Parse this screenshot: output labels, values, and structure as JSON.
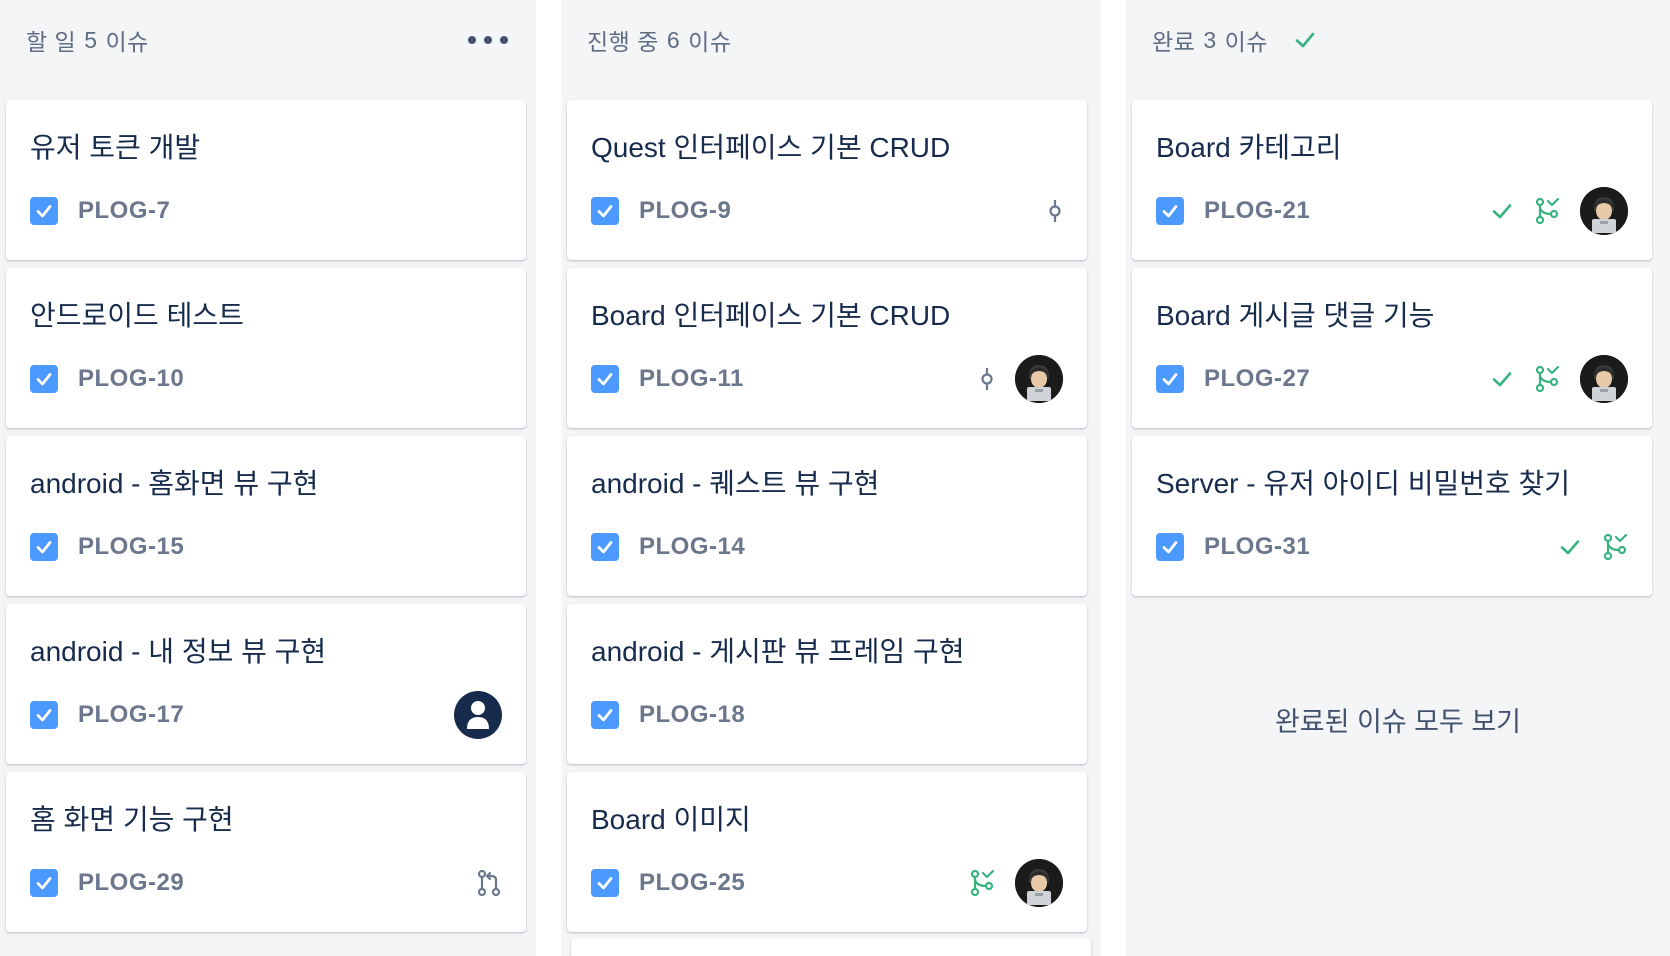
{
  "columns": [
    {
      "name": "할 일",
      "count": "5",
      "issues_label": "이슈",
      "cards": [
        {
          "title": "유저 토큰 개발",
          "key": "PLOG-7"
        },
        {
          "title": "안드로이드 테스트",
          "key": "PLOG-10"
        },
        {
          "title": "android - 홈화면 뷰 구현",
          "key": "PLOG-15"
        },
        {
          "title": "android - 내 정보 뷰 구현",
          "key": "PLOG-17",
          "avatar": "default-user-avatar"
        },
        {
          "title": "홈 화면 기능 구현",
          "key": "PLOG-29",
          "icons": [
            "pull-request-icon"
          ]
        }
      ]
    },
    {
      "name": "진행 중",
      "count": "6",
      "issues_label": "이슈",
      "cards": [
        {
          "title": "Quest 인터페이스 기본 CRUD",
          "key": "PLOG-9",
          "icons": [
            "commit-icon"
          ]
        },
        {
          "title": "Board 인터페이스 기본 CRUD",
          "key": "PLOG-11",
          "icons": [
            "commit-icon"
          ],
          "avatar": "user-photo-avatar"
        },
        {
          "title": "android - 퀘스트 뷰 구현",
          "key": "PLOG-14"
        },
        {
          "title": "android - 게시판 뷰 프레임 구현",
          "key": "PLOG-18"
        },
        {
          "title": "Board 이미지",
          "key": "PLOG-25",
          "icons": [
            "merged-pr-icon"
          ],
          "avatar": "user-photo-avatar"
        }
      ]
    },
    {
      "name": "완료",
      "count": "3",
      "issues_label": "이슈",
      "cards": [
        {
          "title": "Board 카테고리",
          "key": "PLOG-21",
          "icons": [
            "check-icon",
            "merged-pr-icon"
          ],
          "avatar": "user-photo-avatar"
        },
        {
          "title": "Board 게시글 댓글 기능",
          "key": "PLOG-27",
          "icons": [
            "check-icon",
            "merged-pr-icon"
          ],
          "avatar": "user-photo-avatar"
        },
        {
          "title": "Server - 유저 아이디 비밀번호 찾기",
          "key": "PLOG-31",
          "icons": [
            "check-icon",
            "merged-pr-icon"
          ]
        }
      ],
      "view_all": "완료된 이슈 모두 보기"
    }
  ],
  "colors": {
    "column_bg": "#f4f5f7",
    "story_blue": "#4c9aff",
    "done_green": "#36b37e",
    "text_dark": "#172b4d",
    "text_muted": "#6b778c"
  }
}
